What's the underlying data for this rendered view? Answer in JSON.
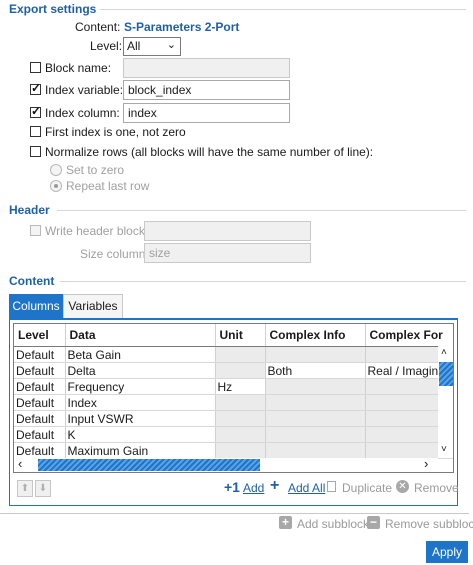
{
  "export_settings": {
    "title": "Export settings",
    "content_label": "Content:",
    "content_value": "S-Parameters 2-Port",
    "level_label": "Level:",
    "level_value": "All",
    "block_name_label": "Block name:",
    "block_name_value": "",
    "block_name_checked": false,
    "index_variable_label": "Index variable:",
    "index_variable_value": "block_index",
    "index_variable_checked": true,
    "index_column_label": "Index column:",
    "index_column_value": "index",
    "index_column_checked": true,
    "first_index_label": "First index is one, not zero",
    "first_index_checked": false,
    "normalize_label": "Normalize rows (all blocks will have the same number of line):",
    "normalize_checked": false,
    "set_to_zero_label": "Set to zero",
    "repeat_last_row_label": "Repeat last row"
  },
  "header": {
    "title": "Header",
    "write_header_label": "Write header block:",
    "write_header_value": "",
    "size_column_label": "Size column:",
    "size_column_value": "size"
  },
  "content": {
    "title": "Content",
    "tabs": [
      "Columns",
      "Variables"
    ],
    "columns": [
      "Level",
      "Data",
      "Unit",
      "Complex Info",
      "Complex For"
    ],
    "rows": [
      [
        "Default",
        "Beta Gain",
        "",
        "",
        ""
      ],
      [
        "Default",
        "Delta",
        "",
        "Both",
        "Real / Imaginar"
      ],
      [
        "Default",
        "Frequency",
        "Hz",
        "",
        ""
      ],
      [
        "Default",
        "Index",
        "",
        "",
        ""
      ],
      [
        "Default",
        "Input VSWR",
        "",
        "",
        ""
      ],
      [
        "Default",
        "K",
        "",
        "",
        ""
      ],
      [
        "Default",
        "Maximum Gain",
        "",
        "",
        ""
      ]
    ],
    "add_label": "Add",
    "add_all_label": "Add All",
    "duplicate_label": "Duplicate",
    "remove_label": "Remove"
  },
  "footer": {
    "add_subblock_label": "Add subblock",
    "remove_subblock_label": "Remove subblock",
    "apply_label": "Apply"
  },
  "colors": {
    "accent": "#1e74c9",
    "section_title": "#1f5fa8"
  }
}
